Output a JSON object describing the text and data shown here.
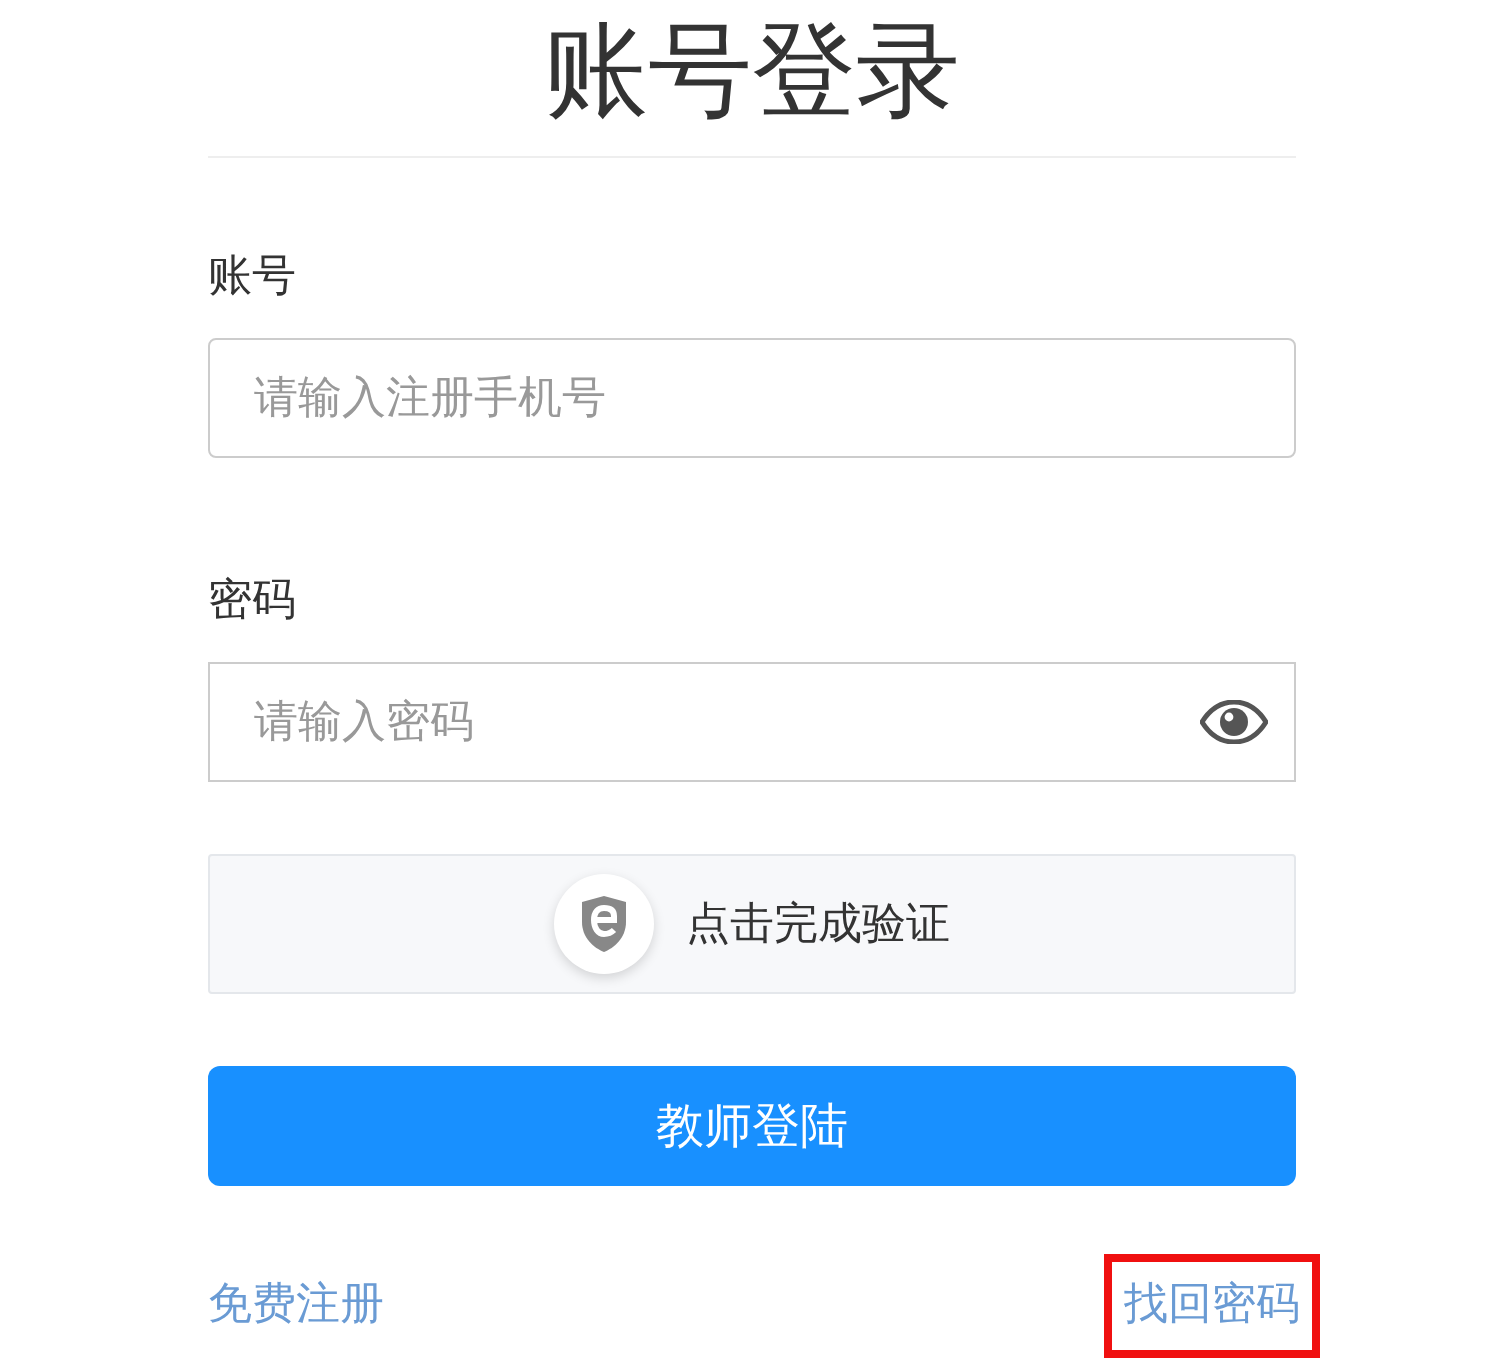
{
  "title": "账号登录",
  "fields": [
    {
      "label": "账号",
      "placeholder": "请输入注册手机号",
      "kind": "text"
    },
    {
      "label": "密码",
      "placeholder": "请输入密码",
      "kind": "password"
    }
  ],
  "captcha": {
    "label": "点击完成验证"
  },
  "submit": {
    "label": "教师登陆"
  },
  "links": [
    {
      "label": "免费注册",
      "highlighted": false
    },
    {
      "label": "找回密码",
      "highlighted": true
    }
  ]
}
